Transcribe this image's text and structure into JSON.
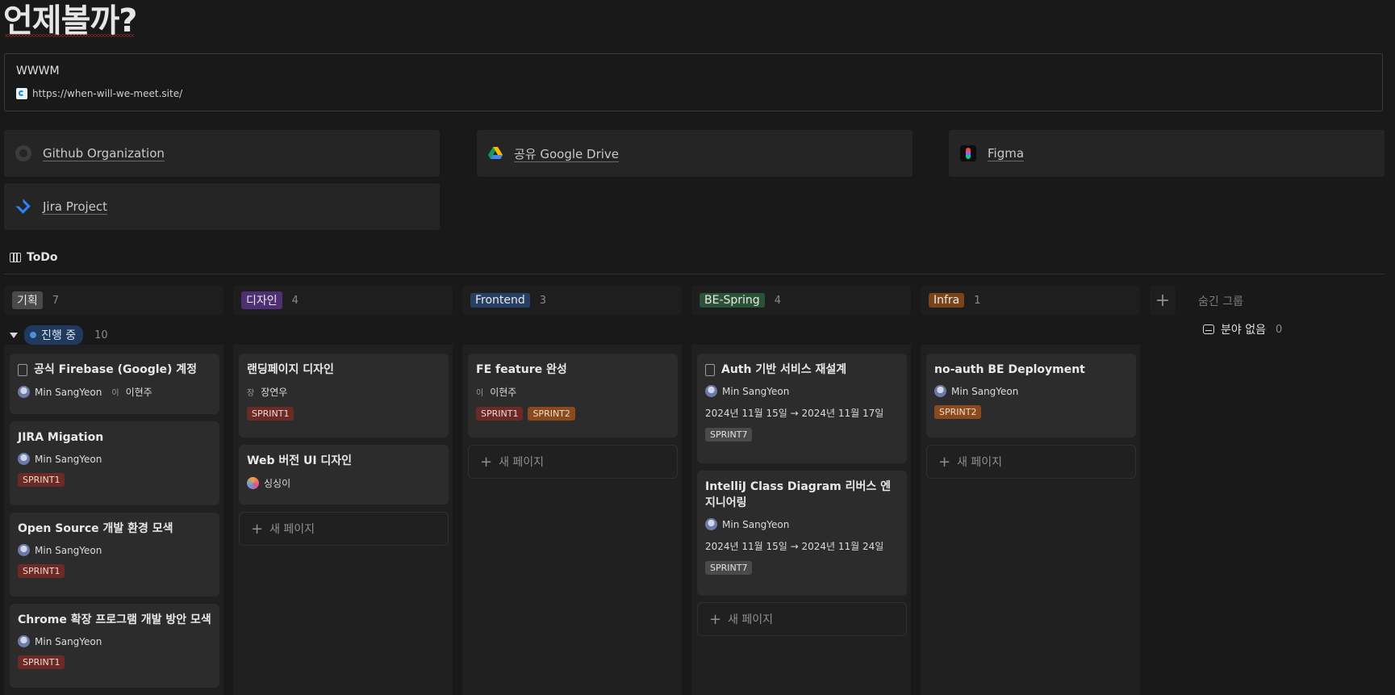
{
  "page": {
    "title": "언제볼까?"
  },
  "bookmark": {
    "title": "WWWM",
    "url": "https://when-will-we-meet.site/"
  },
  "links": [
    {
      "label": "Github Organization",
      "icon": "github-icon"
    },
    {
      "label": "공유 Google Drive",
      "icon": "google-drive-icon"
    },
    {
      "label": "Figma",
      "icon": "figma-icon"
    },
    {
      "label": "Jira Project",
      "icon": "jira-icon"
    }
  ],
  "database": {
    "title": "ToDo",
    "view_icon": "board-icon"
  },
  "columns": [
    {
      "tag": "기획",
      "count": "7",
      "color": "#4a4a4a"
    },
    {
      "tag": "디자인",
      "count": "4",
      "color": "#4e2f73"
    },
    {
      "tag": "Frontend",
      "count": "3",
      "color": "#263f63"
    },
    {
      "tag": "BE-Spring",
      "count": "4",
      "color": "#2a5236"
    },
    {
      "tag": "Infra",
      "count": "1",
      "color": "#7a4418"
    }
  ],
  "add_column": "+",
  "hidden_groups": {
    "label": "숨긴 그룹",
    "no_category_label": "분야 없음",
    "no_category_count": "0"
  },
  "group": {
    "status": "진행 중",
    "count": "10"
  },
  "new_page_label": "새 페이지",
  "cards": {
    "c1": {
      "title": "공식 Firebase (Google) 계정",
      "person1": "Min SangYeon",
      "person2_initial": "이",
      "person2": "이현주"
    },
    "c2": {
      "title": "JIRA Migation",
      "person": "Min SangYeon",
      "chip": "SPRINT1"
    },
    "c3": {
      "title": "Open Source 개발 환경 모색",
      "person": "Min SangYeon",
      "chip": "SPRINT1"
    },
    "c4": {
      "title": "Chrome 확장 프로그램 개발 방안 모색",
      "person": "Min SangYeon",
      "chip": "SPRINT1"
    },
    "d1": {
      "title": "랜딩페이지 디자인",
      "person_initial": "장",
      "person": "장연우",
      "chip": "SPRINT1"
    },
    "d2": {
      "title": "Web 버전 UI 디자인",
      "person": "싱싱이"
    },
    "f1": {
      "title": "FE feature 완성",
      "person_initial": "이",
      "person": "이현주",
      "chip1": "SPRINT1",
      "chip2": "SPRINT2"
    },
    "b1": {
      "title": "Auth 기반 서비스 재설계",
      "person": "Min SangYeon",
      "date": "2024년 11월 15일 → 2024년 11월 17일",
      "chip": "SPRINT7"
    },
    "b2": {
      "title": "IntelliJ Class Diagram 리버스 엔지니어링",
      "person": "Min SangYeon",
      "date": "2024년 11월 15일 → 2024년 11월 24일",
      "chip": "SPRINT7"
    },
    "i1": {
      "title": "no-auth BE Deployment",
      "person": "Min SangYeon",
      "chip": "SPRINT2"
    }
  }
}
